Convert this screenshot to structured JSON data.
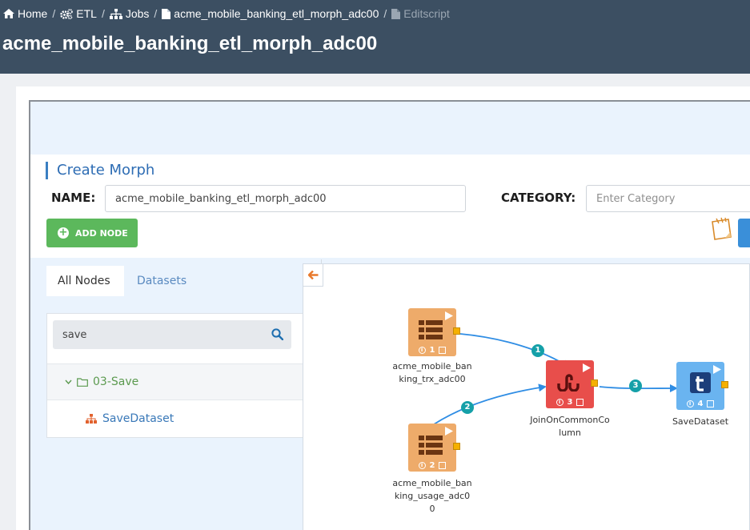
{
  "breadcrumb": {
    "items": [
      {
        "label": "Home",
        "icon": "home-icon"
      },
      {
        "label": "ETL",
        "icon": "gears-icon"
      },
      {
        "label": "Jobs",
        "icon": "sitemap-icon"
      },
      {
        "label": "acme_mobile_banking_etl_morph_adc00",
        "icon": "file-icon"
      },
      {
        "label": "Editscript",
        "icon": "file-icon"
      }
    ],
    "separator": "/"
  },
  "page_title": "acme_mobile_banking_etl_morph_adc00",
  "form": {
    "title": "Create Morph",
    "name_label": "NAME:",
    "name_value": "acme_mobile_banking_etl_morph_adc00",
    "category_label": "CATEGORY:",
    "category_placeholder": "Enter Category",
    "add_node_label": "ADD NODE"
  },
  "left_panel": {
    "tabs": [
      {
        "label": "All Nodes",
        "active": true
      },
      {
        "label": "Datasets",
        "active": false
      }
    ],
    "search_value": "save",
    "tree": {
      "folder": "03-Save",
      "items": [
        "SaveDataset"
      ]
    }
  },
  "canvas": {
    "nodes": [
      {
        "id": 1,
        "label": "acme_mobile_banking_trx_adc00",
        "icon": "table-icon",
        "color": "#eeab6a"
      },
      {
        "id": 2,
        "label": "acme_mobile_banking_usage_adc00",
        "icon": "table-icon",
        "color": "#eeab6a"
      },
      {
        "id": 3,
        "label": "JoinOnCommonColumn",
        "icon": "stumbleupon-icon",
        "color": "#e84e4b"
      },
      {
        "id": 4,
        "label": "SaveDataset",
        "icon": "tumblr-icon",
        "color": "#6ab4f0"
      }
    ],
    "edges": [
      {
        "label": "1",
        "from": 1,
        "to": 3
      },
      {
        "label": "2",
        "from": 2,
        "to": 3
      },
      {
        "label": "3",
        "from": 3,
        "to": 4
      }
    ]
  },
  "colors": {
    "header_bg": "#3c4f62",
    "accent_blue": "#2e6db4",
    "add_button": "#5cb85c",
    "edge_badge": "#15a0a8",
    "edge_line": "#2f8de4"
  }
}
